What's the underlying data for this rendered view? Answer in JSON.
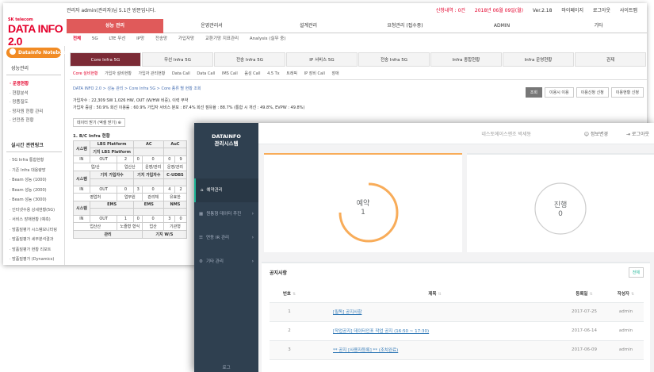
{
  "win1": {
    "greeting": "관리자 admin(관리자)님 5.1간 방문입니다.",
    "top_right": [
      "신청내역 : 0건",
      "2018년 06월 09일(월)",
      "Ver.2.18",
      "마이페이지",
      "로그아웃",
      "사이트맵"
    ],
    "logo_sk": "SK telecom",
    "logo_text": "DATA INFO 2.0",
    "gnb": [
      "성능 관리",
      "운영관리서",
      "설계관리",
      "요청관리 (접수중)",
      "ADMIN",
      "기타"
    ],
    "subnav": [
      "전체",
      "5G",
      "LTE 무선",
      "IP망",
      "전송망",
      "가입자망",
      "교환기망 지표관리",
      "Analysis (실무 중)"
    ],
    "notebook": "DataInfo Notebook",
    "side_title": "성능관리",
    "side_items": [
      "· 운용현황",
      "· 현황분석",
      "· 망품질도",
      "· 망자원 현황 관리",
      "· 안전증 현황"
    ],
    "links_title": "실시간 관련링크",
    "links": [
      "· 5G Infra 통합현황",
      "· 기존 Infra 대용량망",
      "· Beam 성능 (1000)",
      "· Beam 성능 (2000)",
      "· Beam 성능 (3000)",
      "· 인터넷수용 상세현황(5G)",
      "· 서비스 장애현황 (예측)",
      "· 망품질평가 시스템모니터링",
      "· 망품질평가 세부분석결과",
      "· 망품질평가 현황 리포트",
      "· 망품질평가 (Dynamics)"
    ],
    "tabs": [
      "Core Infra 5G",
      "무선 Infra 5G",
      "전송 Infra 5G",
      "IP 서비스 5G",
      "전송 Infra 5G",
      "Infra 종합현황",
      "Infra 운영현황",
      "관제"
    ],
    "subtabs": [
      "Core 설비현황",
      "가입자 설비현황",
      "가입자 관리현황",
      "Data Call",
      "Data Call",
      "IMS Call",
      "음성 Call",
      "4.5 Tx",
      "트래픽",
      "IP 장비 Call",
      "장애"
    ],
    "breadcrumb": "DATA INFO 2.0 > 성능 관리 > Core Infra 5G > Core 종류 별 현황 조회",
    "buttons": [
      "조회",
      "이용시 이용",
      "이용신청 신청",
      "이용현황 신청"
    ],
    "metric1": "가입자수 : 22,309 SW 1,026 HW, OUT (W/HW 비중), 이력 무약",
    "metric2": "가입자 증감 : 50.9%   회선 이용률 : 60.9%   가입자 서비스 분포 : 87.4%   회선 점유율 : 88.7% (통합 시 개선 : 49.8%, EVPW : 49.8%)",
    "download": "데이터 받기 (엑셀 받기) ⊕",
    "section": "1. B/C Infra 현황",
    "table_a_head": [
      "시스템",
      "LBS Platform",
      "AC",
      "AuC"
    ],
    "table_a_sub": "기지 LBS Platform",
    "table_a_row": [
      "IN",
      "OUT",
      "2",
      "0",
      "0",
      "0",
      "9",
      "0"
    ],
    "table_a_label": [
      "업/산",
      "업산산",
      "운영/관리",
      "운영/관리"
    ],
    "table_b_head": [
      "시스템",
      "기지 가입자수",
      "기지 가입자수",
      "C-UDBS"
    ],
    "table_b_row": [
      "IN",
      "OUT",
      "0",
      "3",
      "0",
      "4",
      "2",
      "0"
    ],
    "table_b_label": [
      "영업처",
      "업무원",
      "관리체",
      "유효한"
    ],
    "table_c_head": [
      "시스템",
      "EMS",
      "EMS",
      "NMS"
    ],
    "table_c_row": [
      "IN",
      "OUT",
      "1",
      "0",
      "0",
      "3",
      "0",
      "0"
    ],
    "table_c_label": [
      "업산산",
      "노즐형 형식",
      "업산",
      "기관형"
    ],
    "table_d_head": [
      "관리",
      "기지 W/S"
    ]
  },
  "win2": {
    "brand_line1": "DATAINFO",
    "brand_line2": "관리시스템",
    "menu": [
      {
        "label": "예약관리",
        "active": true,
        "chevron": ""
      },
      {
        "label": "원통형 데이터 추진",
        "active": false,
        "chevron": "›"
      },
      {
        "label": "연동 IR 관리",
        "active": false,
        "chevron": "›"
      },
      {
        "label": "기타 관리",
        "active": false,
        "chevron": "›"
      }
    ],
    "footer": "로그",
    "user_text": "네스토에이스엔조 박세동",
    "info_link": "정보변경",
    "logout_link": "로그아웃",
    "gauge1": {
      "label": "예약",
      "value": "1",
      "color": "#f8ac59"
    },
    "gauge2": {
      "label": "진행",
      "value": "0",
      "color": "#cccccc"
    },
    "notice_title": "공지사항",
    "notice_more": "전체",
    "columns": [
      "번호",
      "제목",
      "등록일",
      "작성자"
    ],
    "rows": [
      {
        "no": "1",
        "title": "[필독] 공지사항",
        "date": "2017-07-25",
        "author": "admin"
      },
      {
        "no": "2",
        "title": "[작업공지] 데이터인포 작업 공지 (16:50 ~ 17:30)",
        "date": "2017-06-14",
        "author": "admin"
      },
      {
        "no": "3",
        "title": "** 공지 [사용자등록] ** (조치완료)",
        "date": "2017-06-09",
        "author": "admin"
      }
    ]
  }
}
